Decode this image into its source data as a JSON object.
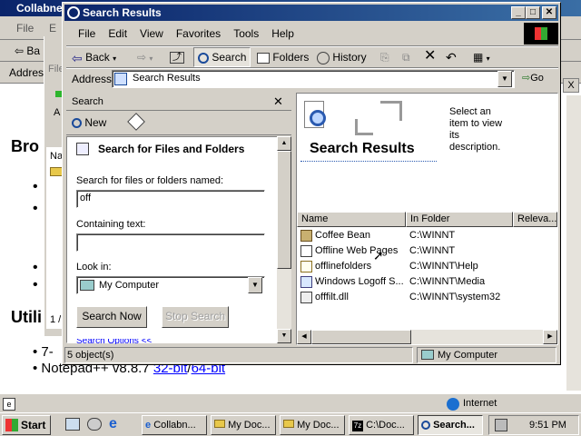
{
  "bg_window": {
    "title": "Collabne",
    "menu_file": "File",
    "menu_e": "E",
    "back_short": "Ba",
    "address_short": "Addres",
    "heading1": "Bro",
    "heading2": "Utili",
    "bullet_7": "7-",
    "notepad_text": "Notepad++ v8.8.7",
    "notepad_link1": "32-bit",
    "notepad_sep": "/",
    "notepad_link2": "64-bit",
    "page_indicator": "1 /",
    "status_internet": "Internet",
    "right_x": "X"
  },
  "mid_window": {
    "file_short": "File",
    "a_short": "A",
    "na_short": "Na"
  },
  "window": {
    "title": "Search Results",
    "min": "_",
    "max": "□",
    "close": "✕"
  },
  "menu": [
    "File",
    "Edit",
    "View",
    "Favorites",
    "Tools",
    "Help"
  ],
  "toolbar": {
    "back": "Back",
    "search": "Search",
    "folders": "Folders",
    "history": "History"
  },
  "address": {
    "label": "Address",
    "value": "Search Results",
    "go": "Go"
  },
  "search_pane": {
    "header": "Search",
    "new_label": "New",
    "section_title": "Search for Files and Folders",
    "named_label": "Search for files or folders named:",
    "named_value": "off",
    "containing_label": "Containing text:",
    "containing_value": "",
    "lookin_label": "Look in:",
    "lookin_value": "My Computer",
    "search_now": "Search Now",
    "stop_search": "Stop Search",
    "options": "Search Options <<"
  },
  "results": {
    "title": "Search Results",
    "description": "Select an item to view its description.",
    "columns": [
      "Name",
      "In Folder",
      "Releva..."
    ],
    "rows": [
      {
        "name": "Coffee Bean",
        "folder": "C:\\WINNT"
      },
      {
        "name": "Offline Web Pages",
        "folder": "C:\\WINNT"
      },
      {
        "name": "offlinefolders",
        "folder": "C:\\WINNT\\Help"
      },
      {
        "name": "Windows Logoff S...",
        "folder": "C:\\WINNT\\Media"
      },
      {
        "name": "offfilt.dll",
        "folder": "C:\\WINNT\\system32"
      }
    ]
  },
  "statusbar": {
    "count": "5 object(s)",
    "zone": "My Computer"
  },
  "taskbar": {
    "start": "Start",
    "tasks": [
      "Collabn...",
      "My Doc...",
      "My Doc...",
      "C:\\Doc...",
      "Search..."
    ],
    "clock": "9:51 PM"
  },
  "colors": {
    "title_active": "#0a246a",
    "face": "#d4d0c8",
    "link": "#0000ff"
  }
}
